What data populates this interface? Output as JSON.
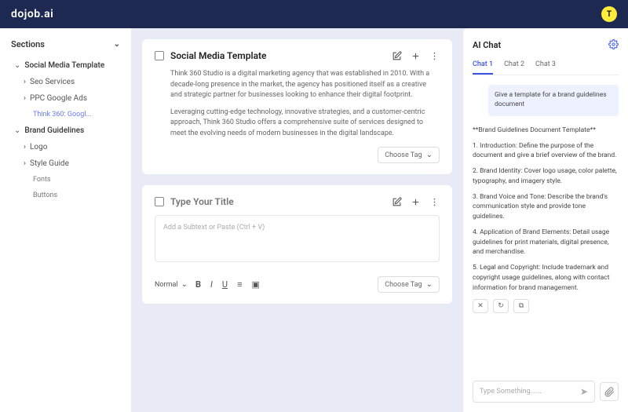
{
  "header": {
    "logo": "dojob.ai",
    "avatar_initial": "T"
  },
  "sidebar": {
    "title": "Sections",
    "groups": [
      {
        "label": "Social Media Template",
        "items": [
          {
            "label": "Seo Services"
          },
          {
            "label": "PPC Google Ads",
            "children": [
              {
                "label": "Think 360: Googl..."
              }
            ]
          }
        ]
      },
      {
        "label": "Brand Guidelines",
        "items": [
          {
            "label": "Logo"
          },
          {
            "label": "Style Guide",
            "children": [
              {
                "label": "Fonts"
              },
              {
                "label": "Buttons"
              }
            ]
          }
        ]
      }
    ]
  },
  "card1": {
    "title": "Social Media Template",
    "p1": "Think 360 Studio is a digital marketing agency that was established in 2010. With a decade-long presence in the market, the agency has positioned itself as a creative and strategic partner for businesses looking to enhance their digital footprint.",
    "p2": "Leveraging cutting-edge technology, innovative strategies, and a customer-centric approach, Think 360 Studio offers a comprehensive suite of services designed to meet the evolving needs of modern businesses in the digital landscape.",
    "choose_tag": "Choose Tag"
  },
  "card2": {
    "title_placeholder": "Type Your Title",
    "subtext_placeholder": "Add a Subtext or Paste (Ctrl + V)",
    "format_label": "Normal",
    "choose_tag": "Choose Tag"
  },
  "ai": {
    "title": "AI Chat",
    "tabs": [
      "Chat 1",
      "Chat 2",
      "Chat 3"
    ],
    "user_msg": "Give a template for a brand guidelines document",
    "reply": {
      "heading": "**Brand Guidelines Document Template**",
      "p1": "1. Introduction: Define the purpose of the document and give a brief overview of the brand.",
      "p2": "2. Brand Identity: Cover logo usage, color palette, typography, and imagery style.",
      "p3": "3. Brand Voice and Tone: Describe the brand's communication style and provide tone guidelines.",
      "p4": "4. Application of Brand Elements: Detail usage guidelines for print materials, digital presence, and merchandise.",
      "p5": "5. Legal and Copyright: Include trademark and copyright usage guidelines, along with contact information for brand management."
    },
    "input_placeholder": "Type Something......"
  }
}
